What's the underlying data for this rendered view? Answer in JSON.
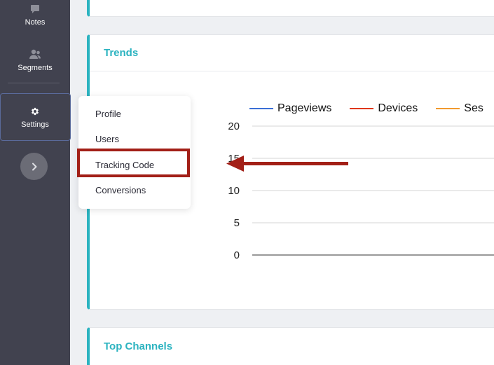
{
  "sidebar": {
    "items": [
      {
        "label": "Notes",
        "icon": "comment-icon"
      },
      {
        "label": "Segments",
        "icon": "users-icon"
      },
      {
        "label": "Settings",
        "icon": "gear-icon"
      }
    ],
    "expand_icon": "chevron-right-icon"
  },
  "cards": {
    "trends_title": "Trends",
    "channels_title": "Top Channels"
  },
  "dropdown": {
    "items": [
      "Profile",
      "Users",
      "Tracking Code",
      "Conversions"
    ],
    "highlighted": "Tracking Code"
  },
  "colors": {
    "accent": "#2bb3c0",
    "sidebar": "#41424f",
    "highlight": "#a21f17"
  },
  "chart_data": {
    "type": "line",
    "series": [
      {
        "name": "Pageviews",
        "color": "#3b6fd6",
        "values": []
      },
      {
        "name": "Devices",
        "color": "#e0371c",
        "values": []
      },
      {
        "name": "Ses",
        "color": "#f29a2e",
        "values": []
      }
    ],
    "yticks": [
      "20",
      "15",
      "10",
      "5",
      "0"
    ],
    "ylim": [
      0,
      20
    ],
    "grid": true,
    "legend_position": "top"
  }
}
